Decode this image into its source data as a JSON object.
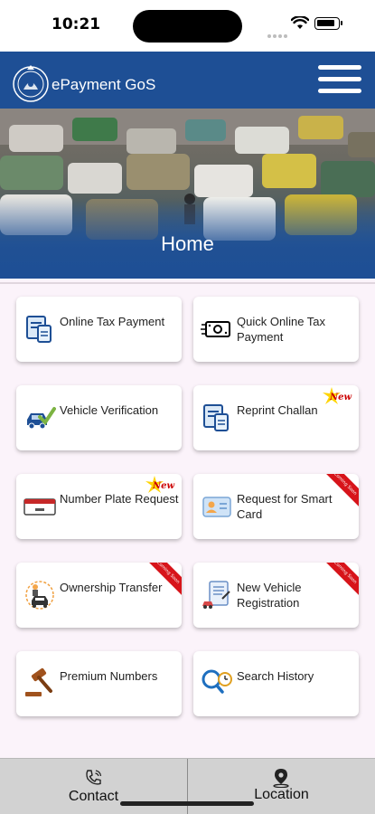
{
  "status_bar": {
    "time": "10:21"
  },
  "header": {
    "app_title": "ePayment GoS",
    "logo": "sindh-govt-emblem",
    "menu_icon": "hamburger-menu-icon"
  },
  "banner": {
    "title": "Home",
    "image": "traffic-jam-photo"
  },
  "cards": [
    {
      "label": "Online Tax Payment",
      "icon": "document-tax-icon",
      "badge": ""
    },
    {
      "label": "Quick Online Tax Payment",
      "icon": "cash-money-icon",
      "badge": ""
    },
    {
      "label": "Vehicle Verification",
      "icon": "car-check-icon",
      "badge": ""
    },
    {
      "label": "Reprint Challan",
      "icon": "document-tax-icon",
      "badge": "New"
    },
    {
      "label": "Number Plate Request",
      "icon": "number-plate-icon",
      "badge": "New"
    },
    {
      "label": "Request for Smart Card",
      "icon": "id-card-icon",
      "badge": "Coming Soon"
    },
    {
      "label": "Ownership Transfer",
      "icon": "ownership-transfer-icon",
      "badge": "Coming Soon"
    },
    {
      "label": "New Vehicle Registration",
      "icon": "registration-form-icon",
      "badge": "Coming Soon"
    },
    {
      "label": "Premium Numbers",
      "icon": "gavel-icon",
      "badge": ""
    },
    {
      "label": "Search History",
      "icon": "search-clock-icon",
      "badge": ""
    }
  ],
  "bottom_nav": [
    {
      "label": "Contact",
      "icon": "phone-icon"
    },
    {
      "label": "Location",
      "icon": "location-pin-icon"
    }
  ]
}
